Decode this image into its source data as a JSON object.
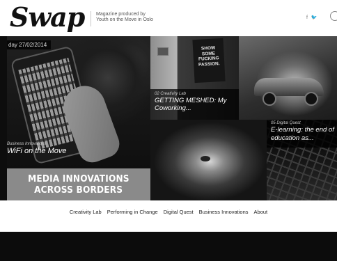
{
  "header": {
    "logo": "Swap",
    "tagline_line1": "Magazine produced by",
    "tagline_line2": "Youth on the Move in Oslo",
    "social": [
      {
        "icon": "facebook-icon",
        "glyph": "f"
      },
      {
        "icon": "twitter-icon",
        "glyph": "♥"
      }
    ]
  },
  "hero": {
    "date": "day 27/02/2014",
    "phone": {
      "category": "Business Innovations",
      "title": "WiFi on the Move"
    },
    "banner": {
      "line1": "MEDIA INNOVATIONS",
      "line2": "ACROSS BORDERS"
    },
    "passion": {
      "poster": [
        "SHOW",
        "SOME",
        "FUCKING",
        "PASSION."
      ],
      "category": "02 Creativity Lab",
      "title": "GETTING MESHED: My Coworking..."
    },
    "keys": {
      "category": "05 Digital Quest",
      "title_line1": "E-learning: the end of",
      "title_line2": "education as..."
    }
  },
  "nav": {
    "items": [
      "Creativity Lab",
      "Performing in Change",
      "Digital Quest",
      "Business Innovations",
      "About"
    ]
  },
  "colors": {
    "background": "#ffffff",
    "footer": "#0c0c0c",
    "banner": "#8a8a8a"
  }
}
